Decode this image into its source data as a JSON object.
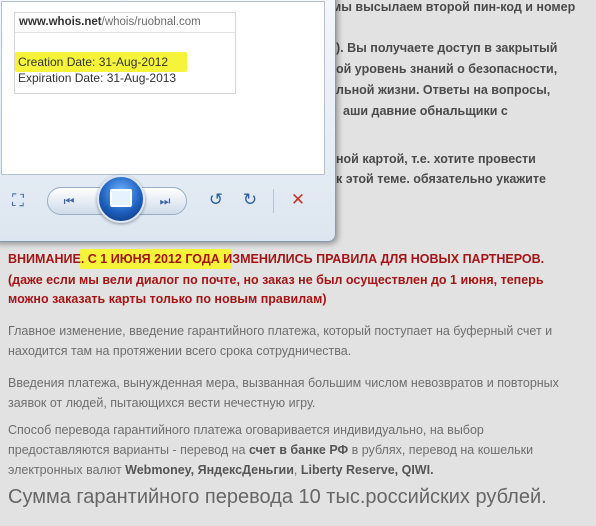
{
  "background_text": {
    "line1": "мы высылаем второй пин-код и номер",
    "line2": "). Вы получаете доступ в закрытый",
    "line3": "ой уровень знаний о безопасности,",
    "line4": "льной жизни. Ответы на вопросы,",
    "line5": "аши давние обнальщики с",
    "line6": "ной картой, т.е. хотите провести",
    "line7": "к этой теме. обязательно укажите"
  },
  "viewer": {
    "url_host": "www.whois.net",
    "url_path": "/whois/ruobnal.com",
    "creation": "Creation Date: 31-Aug-2012",
    "expiration": "Expiration Date: 31-Aug-2013",
    "highlight_color": "#f5f43a"
  },
  "notice": {
    "w1": "ВНИМАНИЕ.",
    "w2": "С 1 ИЮНЯ 2012 ГОДА",
    "w3": "ИЗМЕНИЛИСЬ ПРАВИЛА ДЛЯ НОВЫХ ПАРТНЕРОВ.",
    "sub1": "(даже если мы вели диалог по почте, но заказ не был осуществлен до 1 июня, теперь",
    "sub2": "можно заказать карты только по новым правилам)"
  },
  "paragraphs": {
    "p1a": "Главное изменение, введение гарантийного платежа, который поступает на буферный счет и",
    "p1b": "находится там на протяжении всего срока сотрудничества.",
    "p2a": "Введения платежа, вынужденная мера, вызванная большим числом невозвратов и повторных",
    "p2b": "заявок от людей, пытающихся вести нечестную игру.",
    "p3a": "Способ перевода гарантийного платежа оговаривается индивидуально, на выбор",
    "p3b_1": "предоставляются варианты - перевод на ",
    "p3b_bold": "счет в банке РФ",
    "p3b_2": " в рублях, перевод на кошельки",
    "p3c_1": "электронных валют ",
    "p3c_b1": "Webmoney, ЯндексДеньгии",
    "p3c_2": ", ",
    "p3c_b2": "Liberty Reserve, QIWI.",
    "big": "Сумма гарантийного перевода 10 тыс.российских рублей."
  },
  "colors": {
    "warning": "#a31515",
    "body_text": "#6e6e6e",
    "viewer_accent": "#1e5fbf"
  }
}
